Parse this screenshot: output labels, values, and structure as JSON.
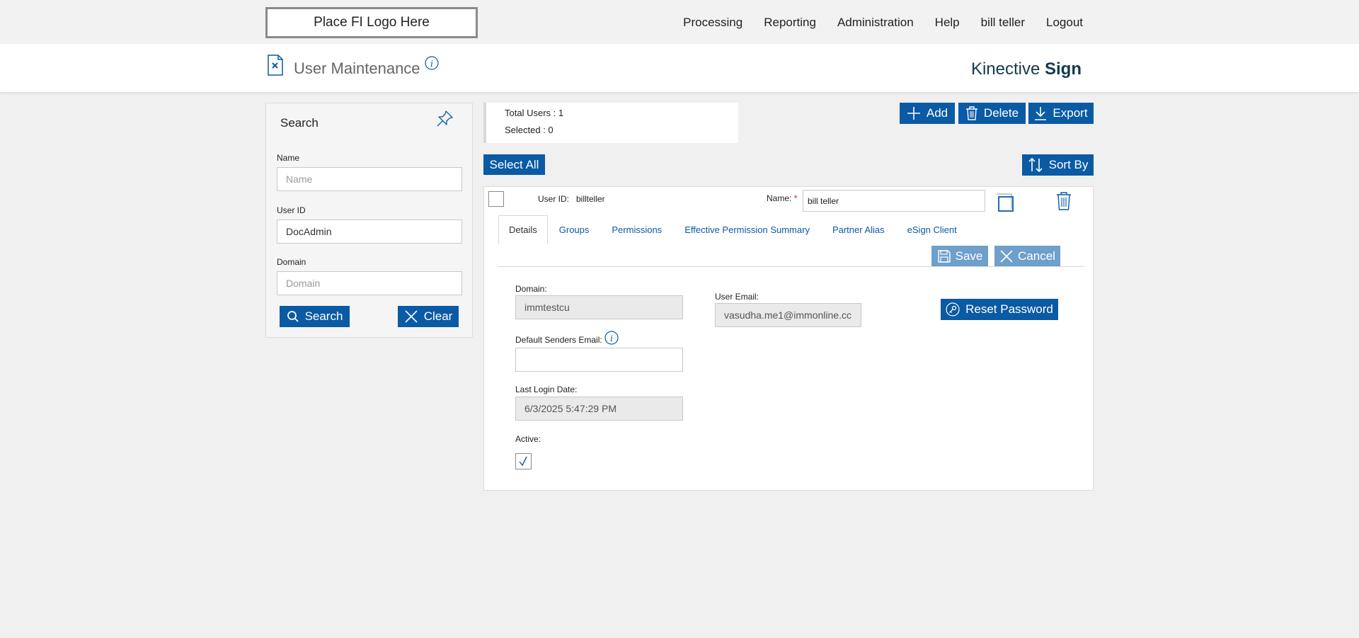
{
  "topbar": {
    "logo": "Place FI Logo Here",
    "nav": [
      "Processing",
      "Reporting",
      "Administration",
      "Help",
      "bill teller",
      "Logout"
    ]
  },
  "header": {
    "title": "User Maintenance",
    "brand_light": "Kinective ",
    "brand_bold": "Sign"
  },
  "search": {
    "title": "Search",
    "name_label": "Name",
    "name_placeholder": "Name",
    "userid_label": "User ID",
    "userid_value": "DocAdmin",
    "domain_label": "Domain",
    "domain_placeholder": "Domain",
    "search_button": "Search",
    "clear_button": "Clear"
  },
  "summary": {
    "total": "Total Users : 1",
    "selected": "Selected : 0"
  },
  "toolbar": {
    "add": "Add",
    "delete": "Delete",
    "export": "Export",
    "select_all": "Select All",
    "sort_by": "Sort By"
  },
  "user": {
    "userid_label": "User ID:",
    "userid_value": "billteller",
    "name_label": "Name:",
    "required_mark": "*",
    "name_value": "bill teller"
  },
  "tabs": [
    "Details",
    "Groups",
    "Permissions",
    "Effective Permission Summary",
    "Partner Alias",
    "eSign Client"
  ],
  "actions": {
    "save": "Save",
    "cancel": "Cancel",
    "reset_password": "Reset Password"
  },
  "details": {
    "domain_label": "Domain:",
    "domain_value": "immtestcu",
    "default_email_label": "Default Senders Email:",
    "default_email_value": "",
    "last_login_label": "Last Login Date:",
    "last_login_value": "6/3/2025 5:47:29 PM",
    "active_label": "Active:",
    "active_checked": true,
    "user_email_label": "User Email:",
    "user_email_value": "vasudha.me1@immonline.cc"
  },
  "colors": {
    "primary": "#0a5aa4",
    "primary_light": "#6f9fcb",
    "brand_text": "#123a4e"
  }
}
